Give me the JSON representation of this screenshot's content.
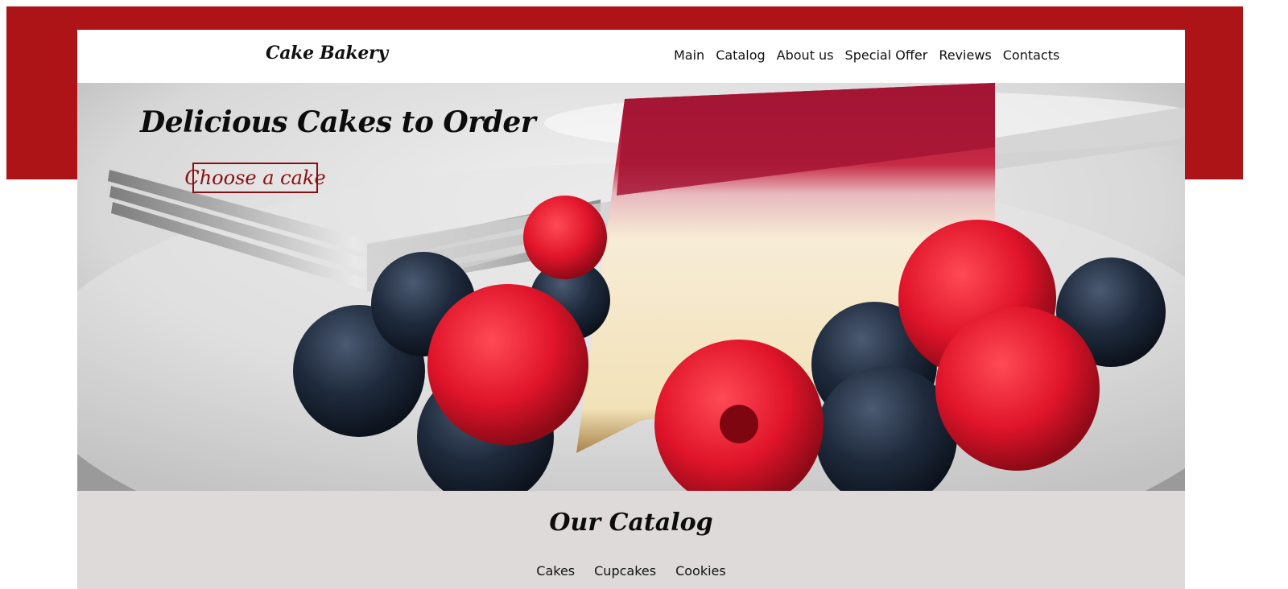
{
  "header": {
    "logo": "Cake Bakery",
    "nav": [
      "Main",
      "Catalog",
      "About us",
      "Special Offer",
      "Reviews",
      "Contacts"
    ]
  },
  "hero": {
    "title": "Delicious Cakes to Order",
    "button_label": "Choose a cake",
    "image_description_icon": "cheesecake-photo"
  },
  "catalog": {
    "title": "Our Catalog",
    "tabs": [
      "Cakes",
      "Cupcakes",
      "Cookies"
    ]
  },
  "colors": {
    "brand_red": "#ad1417",
    "button_red": "#8a0f12",
    "catalog_bg": "#dedada"
  }
}
